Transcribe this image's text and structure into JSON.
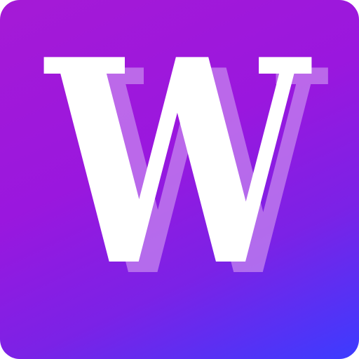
{
  "logo": {
    "letter": "W",
    "gradient_start": "#a51ad6",
    "gradient_end": "#3c3cff",
    "letter_color": "#ffffff",
    "shadow_color": "#c98bf0"
  }
}
